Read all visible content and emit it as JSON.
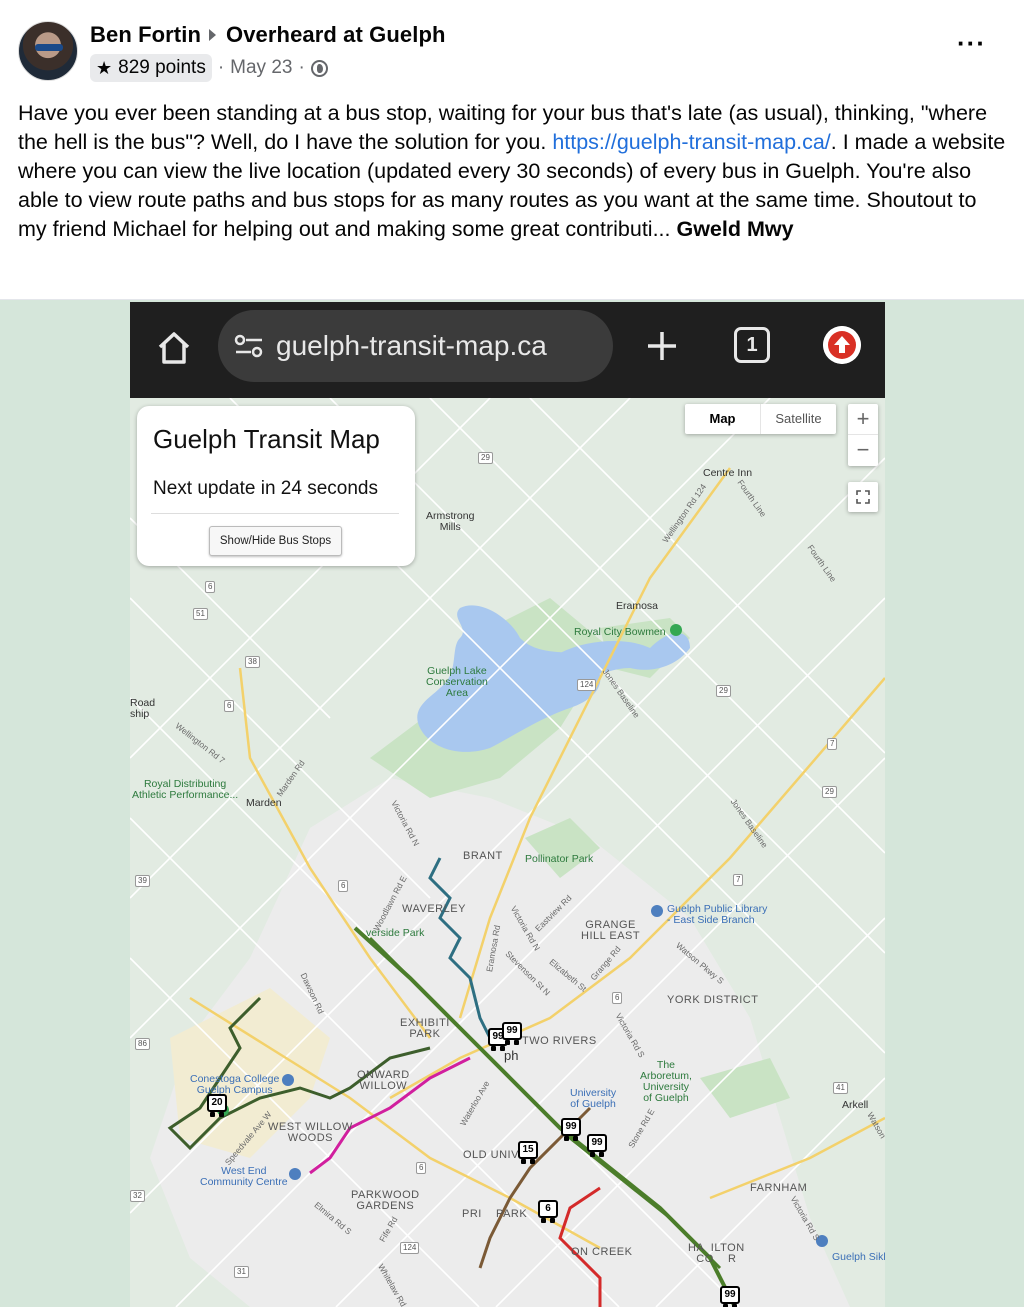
{
  "post": {
    "author": "Ben Fortin",
    "group": "Overheard at Guelph",
    "points": "829 points",
    "date": "May 23",
    "text_before_link": "Have you ever been standing at a bus stop, waiting for your bus that's late (as usual), thinking, \"where the hell is the bus\"? Well, do I have the solution for you. ",
    "link": "https://guelph-transit-map.ca/",
    "text_after_link": ". I made a website where you can view the live location (updated every 30 seconds) of every bus in Guelph. You're also able to view route paths and bus stops for as many routes as you want at the same time. Shoutout to my friend Michael for helping out and making some great contributi... ",
    "see_more": "Gweld Mwy"
  },
  "browser": {
    "url": "guelph-transit-map.ca",
    "tab_count": "1"
  },
  "app": {
    "title": "Guelph Transit Map",
    "next_update": "Next update in 24 seconds",
    "bus_stops_button": "Show/Hide Bus Stops"
  },
  "map_controls": {
    "map": "Map",
    "satellite": "Satellite",
    "zoom_in": "+",
    "zoom_out": "−"
  },
  "places": {
    "centre_inn": "Centre Inn",
    "armstrong_mills": "Armstrong\nMills",
    "eramosa": "Eramosa",
    "royal_city_bowmen": "Royal City Bowmen",
    "guelph_lake": "Guelph Lake\nConservation\nArea",
    "royal_distributing": "Royal Distributing\nAthletic Performance...",
    "marden": "Marden",
    "brant": "BRANT",
    "pollinator_park": "Pollinator Park",
    "waverley": "WAVERLEY",
    "riverside_park": "verside Park",
    "grange_hill_east": "GRANGE\nHILL EAST",
    "guelph_public_library": "Guelph Public Library\n- East Side Branch",
    "york_district": "YORK DISTRICT",
    "exhibition_park": "EXHIBITI\nPARK",
    "two_rivers": "TWO RIVERS",
    "conestoga": "Conestoga College\nGuelph Campus",
    "onward_willow": "ONWARD\nWILLOW",
    "the_arboretum": "The\nArboretum,\nUniversity\nof Guelph",
    "university": "University\nof Guelph",
    "arkell": "Arkell",
    "west_willow_woods": "WEST WILLOW\nWOODS",
    "old_university": "OLD UNIVE",
    "west_end": "West End\nCommunity Centre",
    "parkwood_gardens": "PARKWOOD\nGARDENS",
    "priory_park": "PRI    PARK",
    "farnham": "FARNHAM",
    "hamilton_corner": "HA  ILTON\nCO    R",
    "ron_creek": "ON CREEK",
    "guelph_sikh": "Guelph Sikh",
    "road_ship": "Road\nship",
    "guelph_city": "ph"
  },
  "roads": {
    "wellington_124": "Wellington Rd 124",
    "fourth_line_1": "Fourth Line",
    "fourth_line_2": "Fourth Line",
    "jones_baseline_1": "Jones Baseline",
    "jones_baseline_2": "Jones Baseline",
    "wellington_7": "Wellington Rd 7",
    "marden_rd": "Marden Rd",
    "victoria_n": "Victoria Rd N",
    "woodlawn": "Woodlawn Rd E",
    "eramosa_rd": "Eramosa Rd",
    "victoria_n2": "Victoria Rd N",
    "eastview": "Eastview Rd",
    "stevenson": "Stevenson St N",
    "elizabeth": "Elizabeth St",
    "grange_rd": "Grange Rd",
    "watson": "Watson Pkwy S",
    "dawson": "Dawson Rd",
    "victoria_s": "Victoria Rd S",
    "waterloo": "Waterloo Ave",
    "speedvale": "Speedvale Ave W",
    "stone": "Stone Rd E",
    "elmira": "Elmira Rd S",
    "fife": "Fife Rd",
    "whitelaw": "Whitelaw Rd",
    "victoria_s2": "Victoria Rd S",
    "watson2": "Watson"
  },
  "shields": [
    "29",
    "6",
    "51",
    "38",
    "6",
    "124",
    "29",
    "7",
    "29",
    "39",
    "6",
    "7",
    "86",
    "6",
    "6",
    "41",
    "32",
    "124",
    "31"
  ],
  "buses": [
    "20",
    "99",
    "99",
    "99",
    "15",
    "99",
    "6",
    "99"
  ],
  "route_colors": {
    "green_main": "#4b7d2a",
    "teal": "#2e6f82",
    "magenta": "#d11f9e",
    "dark_green": "#3d5e2c",
    "brown": "#7b5a36",
    "red": "#d42a2a"
  }
}
